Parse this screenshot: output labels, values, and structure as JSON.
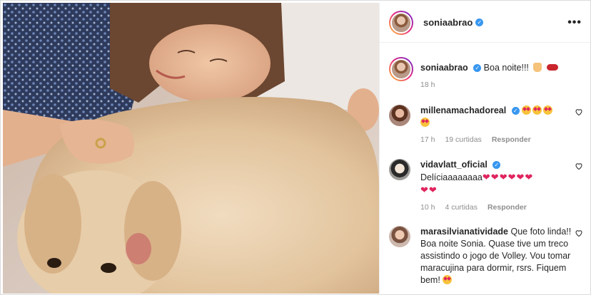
{
  "post": {
    "author": "soniaabrao",
    "more_label": "•••"
  },
  "caption": {
    "user": "soniaabrao",
    "text": "Boa noite!!!",
    "time": "18 h"
  },
  "comments": [
    {
      "user": "millenamachadoreal",
      "text": "",
      "emoji_count": 4,
      "time": "17 h",
      "likes": "19 curtidas",
      "reply": "Responder"
    },
    {
      "user": "vidavlatt_oficial",
      "text": "Delíciaaaaaaaa",
      "hearts": 8,
      "time": "10 h",
      "likes": "4 curtidas",
      "reply": "Responder"
    },
    {
      "user": "marasilvianatividade",
      "text": "Que foto linda!! Boa noite Sonia. Quase tive um treco assistindo o jogo de Volley. Vou tomar maracujina para dormir, rsrs. Fiquem bem!"
    }
  ],
  "colors": {
    "verified": "#3897f0",
    "secondary_text": "#8e8e8e",
    "border": "#dbdbdb"
  },
  "icons": [
    "more-options-icon",
    "verified-icon",
    "heart-icon",
    "emoji-heart-eyes-icon",
    "red-heart-icon",
    "praying-hands-icon",
    "lips-icon"
  ]
}
